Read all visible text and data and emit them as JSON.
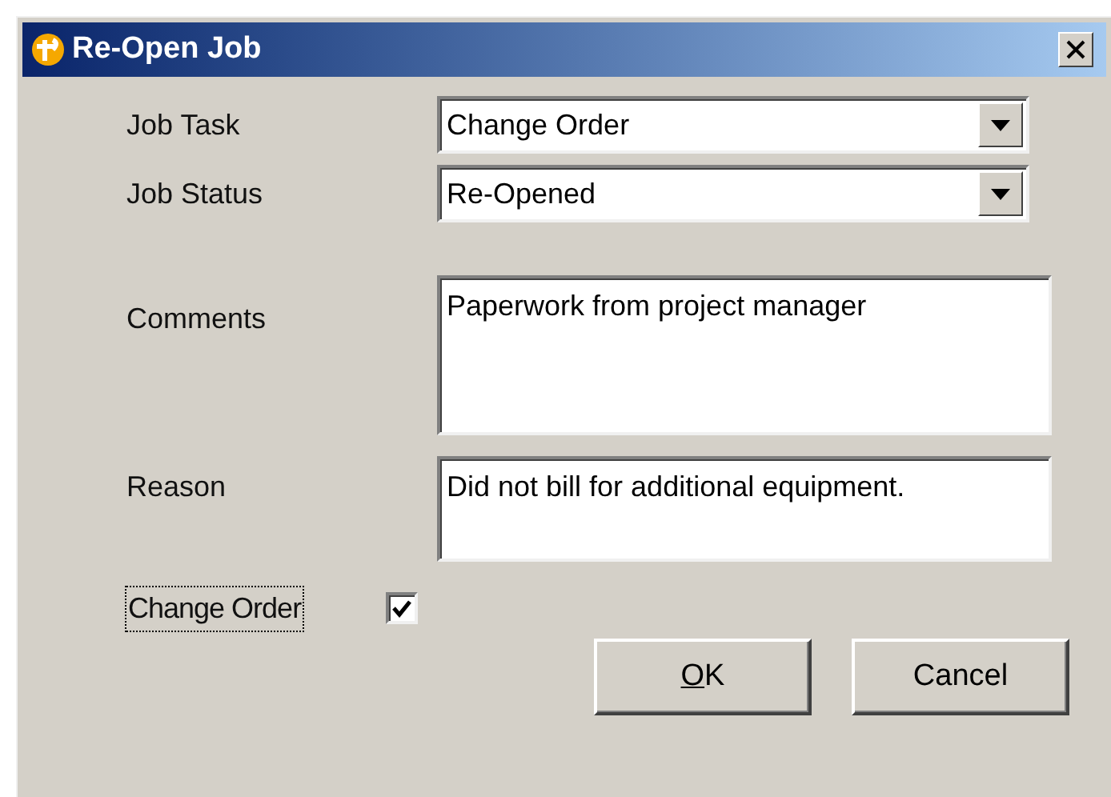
{
  "window": {
    "title": "Re-Open Job"
  },
  "fields": [
    {
      "kind": "select",
      "label": "Job Task",
      "value": "Change Order"
    },
    {
      "kind": "select",
      "label": "Job Status",
      "value": "Re-Opened"
    },
    {
      "kind": "textarea",
      "label": "Comments",
      "value": "Paperwork from project manager",
      "tall": true
    },
    {
      "kind": "textarea",
      "label": "Reason",
      "value": "Did not bill for additional equipment.",
      "tall": false
    },
    {
      "kind": "checkbox",
      "label": "Change Order",
      "checked": true,
      "focused": true
    }
  ],
  "buttons": [
    {
      "label": "OK",
      "access_key_underlined": true
    },
    {
      "label": "Cancel"
    }
  ]
}
